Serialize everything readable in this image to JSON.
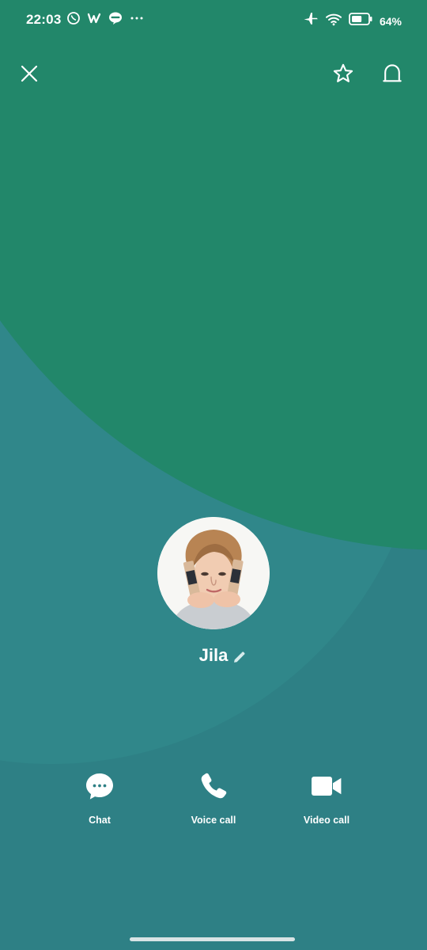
{
  "status_bar": {
    "time": "22:03",
    "battery_percent": "64%",
    "battery_level": 0.64,
    "left_icons": [
      "whatsapp-icon",
      "w-app-icon",
      "line-icon",
      "more-dots-icon"
    ],
    "right_icons": [
      "airplane-icon",
      "wifi-icon",
      "battery-icon"
    ]
  },
  "header": {
    "close_icon": "close-icon",
    "favorite_icon": "star-icon",
    "notification_icon": "bell-icon"
  },
  "profile": {
    "name": "Jila",
    "avatar_icon": "profile-photo",
    "edit_icon": "pencil-icon"
  },
  "actions": [
    {
      "label": "Chat",
      "icon": "chat-bubble-icon"
    },
    {
      "label": "Voice call",
      "icon": "phone-icon"
    },
    {
      "label": "Video call",
      "icon": "video-camera-icon"
    }
  ],
  "colors": {
    "top_green": "#22876A",
    "middle_teal": "#30878A",
    "bottom_teal": "#2E8085",
    "text": "#FFFFFF"
  }
}
